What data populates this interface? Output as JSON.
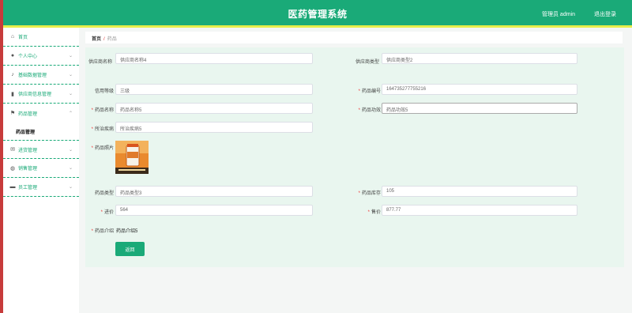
{
  "header": {
    "title": "医药管理系统",
    "user": "管理员 admin",
    "logout": "退出登录"
  },
  "sidebar": {
    "items": [
      {
        "label": "首页",
        "icon": "home-icon"
      },
      {
        "label": "个人中心",
        "icon": "user-icon"
      },
      {
        "label": "基础数据管理",
        "icon": "mic-icon"
      },
      {
        "label": "供应商信息管理",
        "icon": "chart-icon"
      },
      {
        "label": "药品管理",
        "icon": "flag-icon"
      },
      {
        "label": "进货管理",
        "icon": "mail-icon"
      },
      {
        "label": "销售管理",
        "icon": "globe-icon"
      },
      {
        "label": "员工管理",
        "icon": "briefcase-icon"
      }
    ],
    "sub_active": "药品管理"
  },
  "breadcrumb": {
    "home": "首页",
    "sep": "/",
    "current": "药品"
  },
  "form": {
    "supplier_name_label": "供应商名称",
    "supplier_name_placeholder": "供应商名称4",
    "supplier_type_label": "供应商类型",
    "supplier_type_placeholder": "供应商类型2",
    "credit_label": "信用等级",
    "credit_value": "三级",
    "drug_no_label": "药品编号",
    "drug_no_value": "1647352777552​16",
    "drug_name_label": "药品名称",
    "drug_name_placeholder": "药品名称5",
    "drug_effect_label": "药品功效",
    "drug_effect_placeholder": "药品功效5",
    "disease_label": "所治疾病",
    "disease_placeholder": "所治疾病5",
    "photo_label": "药品照片",
    "drug_type_label": "药品类型",
    "drug_type_value": "药品类型3",
    "stock_label": "药品库存",
    "stock_value": "105",
    "purchase_label": "进价",
    "purchase_value": "564",
    "sale_label": "售价",
    "sale_value": "877.77",
    "intro_label": "药品介绍",
    "intro_value": "药品介绍5",
    "back_button": "返回"
  },
  "colors": {
    "brand": "#1aaa78",
    "stripe": "#e7ee4a",
    "panel": "#e9f6ef"
  }
}
